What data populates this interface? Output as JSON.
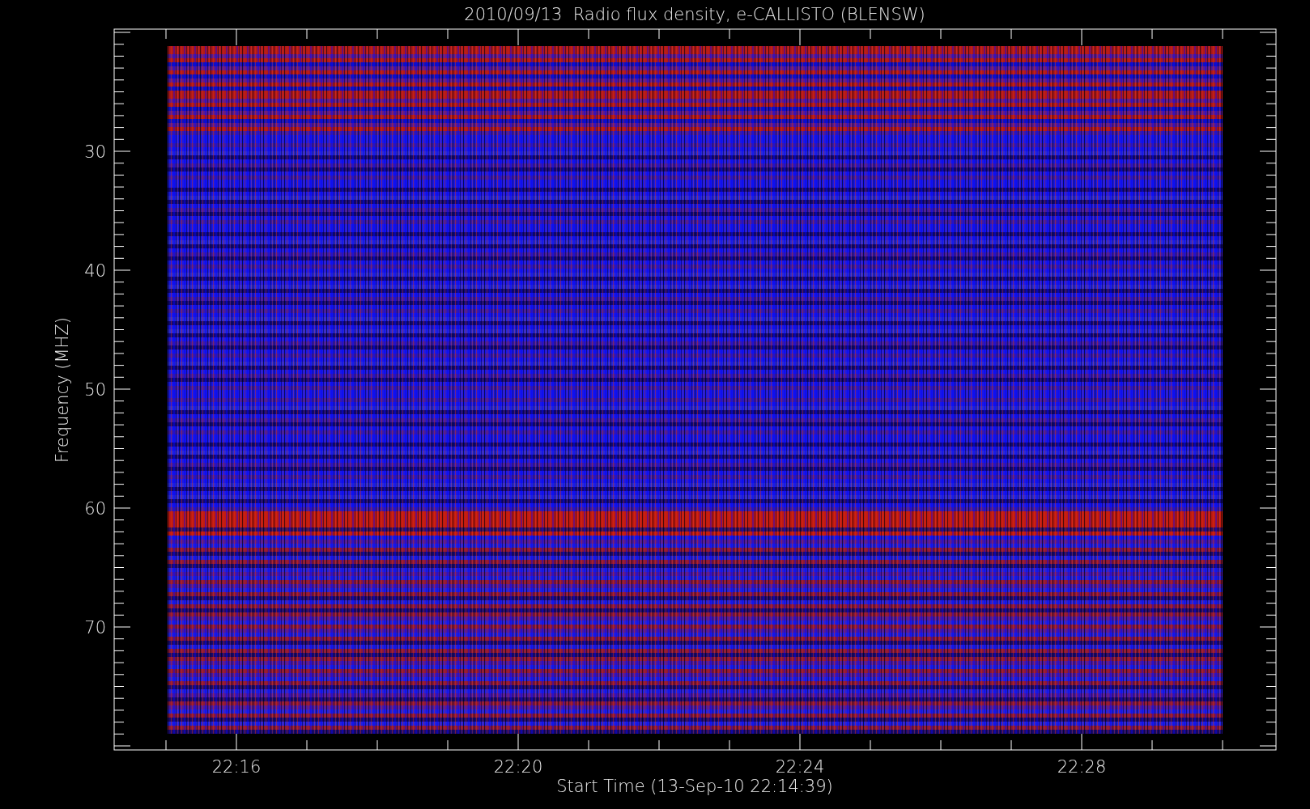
{
  "plot": {
    "title": "2010/09/13  Radio flux density, e-CALLISTO (BLENSW)",
    "ylabel": "Frequency (MHZ)",
    "xlabel": "Start Time (13-Sep-10 22:14:39)",
    "y_tick_labels": [
      "30",
      "40",
      "50",
      "60",
      "70"
    ],
    "x_tick_labels": [
      "22:16",
      "22:20",
      "22:24",
      "22:28"
    ]
  }
}
